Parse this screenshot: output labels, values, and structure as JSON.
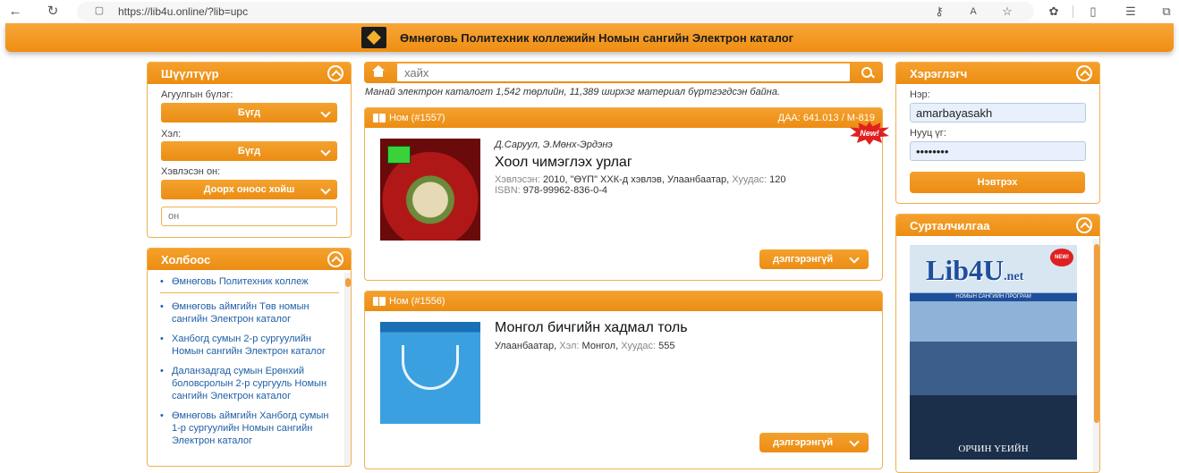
{
  "browser": {
    "url": "https://lib4u.online/?lib=upc"
  },
  "header": {
    "title": "Өмнөговь Политехник коллежийн Номын сангийн Электрон каталог"
  },
  "filter": {
    "title": "Шүүлтүүр",
    "section_label": "Агуулгын бүлэг:",
    "section_value": "Бүгд",
    "language_label": "Хэл:",
    "language_value": "Бүгд",
    "year_label": "Хэвлэсэн он:",
    "year_value": "Доорх оноос хойш",
    "year_placeholder": "он"
  },
  "links": {
    "title": "Холбоос",
    "items": [
      "Өмнөговь Политехник коллеж",
      "Өмнөговь аймгийн Төв номын сангийн Электрон каталог",
      "Ханбогд сумын 2-р сургуулийн Номын сангийн Электрон каталог",
      "Даланзадгад сумын Ерөнхий боловсролын 2-р сургууль Номын сангийн Электрон каталог",
      "Өмнөговь аймгийн Ханбогд сумын 1-р сургуулийн Номын сангийн Электрон каталог"
    ]
  },
  "search": {
    "placeholder": "хайх",
    "note": "Манай электрон каталогт 1,542 төрлийн, 11,389 ширхэг материал бүртгэгдсэн байна."
  },
  "books": [
    {
      "id": "Ном (#1557)",
      "code": "ДАА: 641.013 / М-819",
      "badge": "New!",
      "author": "Д.Саруул, Э.Мөнх-Эрдэнэ",
      "title": "Хоол чимэглэх урлаг",
      "published_key": "Хэвлэсэн:",
      "published_value": "2010, \"ӨҮП\" ХХК-д хэвлэв, Улаанбаатар,",
      "pages_key": "Хуудас:",
      "pages_value": "120",
      "isbn_key": "ISBN:",
      "isbn_value": "978-99962-836-0-4",
      "more": "дэлгэрэнгүй"
    },
    {
      "id": "Ном (#1556)",
      "title": "Монгол бичгийн хадмал толь",
      "place": "Улаанбаатар,",
      "language_key": "Хэл:",
      "language_value": "Монгол,",
      "pages_key": "Хуудас:",
      "pages_value": "555",
      "more": "дэлгэрэнгүй"
    }
  ],
  "user": {
    "title": "Хэрэглэгч",
    "name_label": "Нэр:",
    "name_value": "amarbayasakh",
    "password_label": "Нууц үг:",
    "password_value": "password",
    "login": "Нэвтрэх"
  },
  "ads": {
    "title": "Сурталчилгаа",
    "brand": "Lib4U",
    "brand_suffix": ".net",
    "strip": "НОМЫН САНГИЙН ПРОГРАМ",
    "badge": "NEW!",
    "caption": "ОРЧИН ҮЕИЙН"
  },
  "colors": {
    "accent": "#ec8d14",
    "link": "#1f5fa6"
  }
}
